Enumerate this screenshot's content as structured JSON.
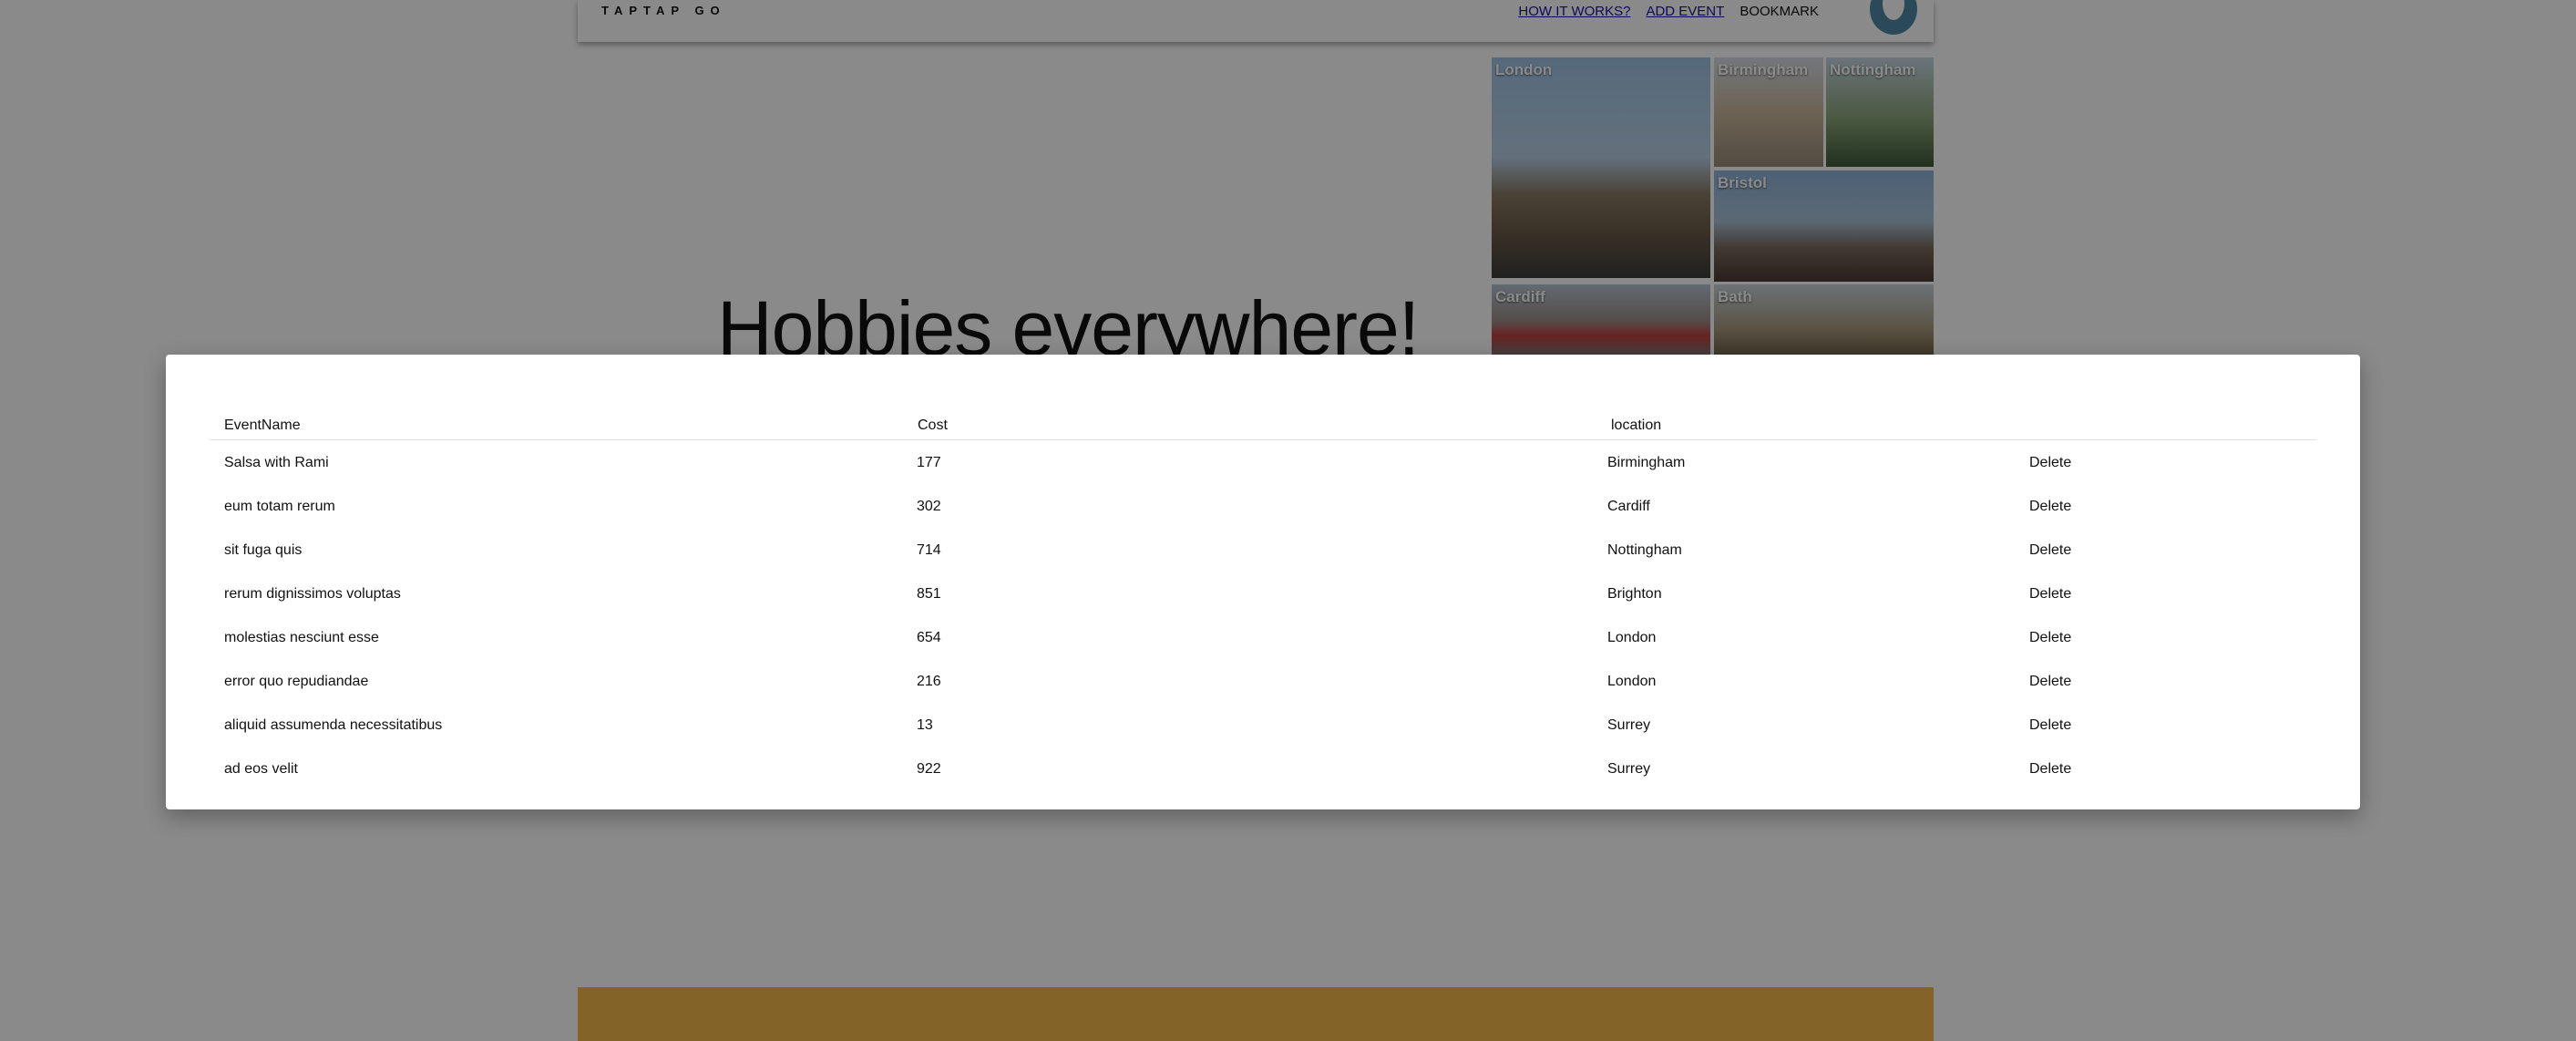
{
  "header": {
    "logo": "TAPTAP GO",
    "nav": {
      "how_it_works": "HOW IT WORKS?",
      "add_event": "ADD EVENT",
      "bookmark": "BOOKMARK"
    }
  },
  "hero": {
    "headline": "Hobbies everywhere!"
  },
  "city_tiles": [
    "London",
    "Birmingham",
    "Nottingham",
    "Bristol",
    "Cardiff",
    "Bath"
  ],
  "table": {
    "columns": [
      "EventName",
      "Cost",
      "location"
    ],
    "delete_label": "Delete",
    "rows": [
      {
        "name": "Salsa with Rami",
        "cost": "177",
        "location": "Birmingham"
      },
      {
        "name": "eum totam rerum",
        "cost": "302",
        "location": "Cardiff"
      },
      {
        "name": "sit fuga quis",
        "cost": "714",
        "location": "Nottingham"
      },
      {
        "name": "rerum dignissimos voluptas",
        "cost": "851",
        "location": "Brighton"
      },
      {
        "name": "molestias nesciunt esse",
        "cost": "654",
        "location": "London"
      },
      {
        "name": "error quo repudiandae",
        "cost": "216",
        "location": "London"
      },
      {
        "name": "aliquid assumenda necessitatibus",
        "cost": "13",
        "location": "Surrey"
      },
      {
        "name": "ad eos velit",
        "cost": "922",
        "location": "Surrey"
      }
    ]
  },
  "colors": {
    "footer": "#f2b74b",
    "avatar": "#4e8aa6",
    "backdrop": "rgba(0,0,0,0.46)"
  }
}
